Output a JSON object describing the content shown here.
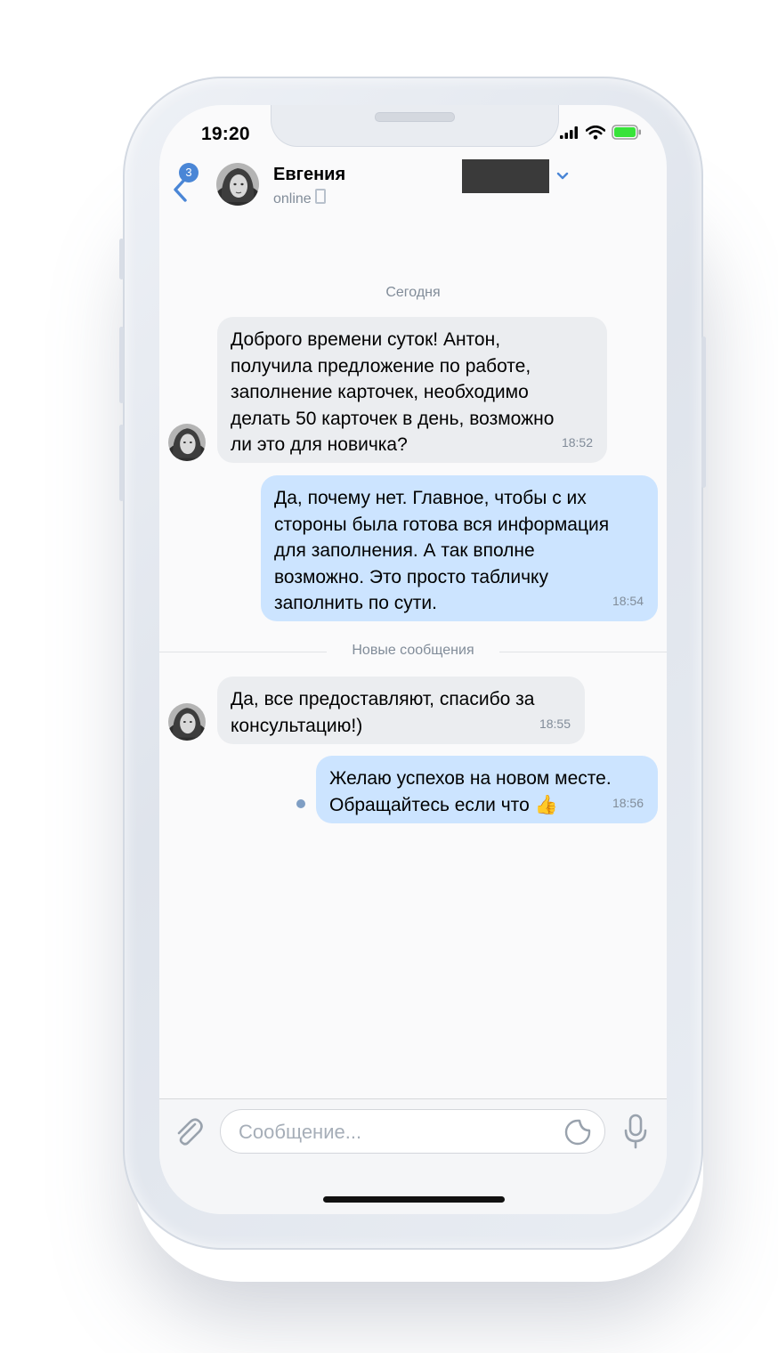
{
  "status_bar": {
    "time": "19:20"
  },
  "header": {
    "unread_count": "3",
    "contact_name": "Евгения",
    "status": "online"
  },
  "chat": {
    "date_label": "Сегодня",
    "new_messages_label": "Новые сообщения",
    "messages": [
      {
        "direction": "incoming",
        "lines": [
          "Доброго времени суток! Антон,",
          "получила предложение по работе,",
          "заполнение карточек, необходимо",
          "делать 50 карточек в день, возможно",
          "ли это для новичка?"
        ],
        "time": "18:52"
      },
      {
        "direction": "outgoing",
        "lines": [
          "Да, почему нет. Главное, чтобы с их",
          "стороны была готова вся информация",
          "для заполнения. А так вполне",
          "возможно. Это просто табличку",
          "заполнить по сути."
        ],
        "time": "18:54"
      },
      {
        "direction": "incoming",
        "lines": [
          "Да, все предоставляют, спасибо за",
          "консультацию!)"
        ],
        "time": "18:55"
      },
      {
        "direction": "outgoing",
        "lines": [
          "Желаю успехов на новом месте.",
          "Обращайтесь если что 👍"
        ],
        "time": "18:56"
      }
    ]
  },
  "composer": {
    "placeholder": "Сообщение..."
  },
  "colors": {
    "accent": "#4a86d6",
    "incoming_bubble": "#ebedf0",
    "outgoing_bubble": "#cce4ff",
    "battery": "#38e33a"
  }
}
